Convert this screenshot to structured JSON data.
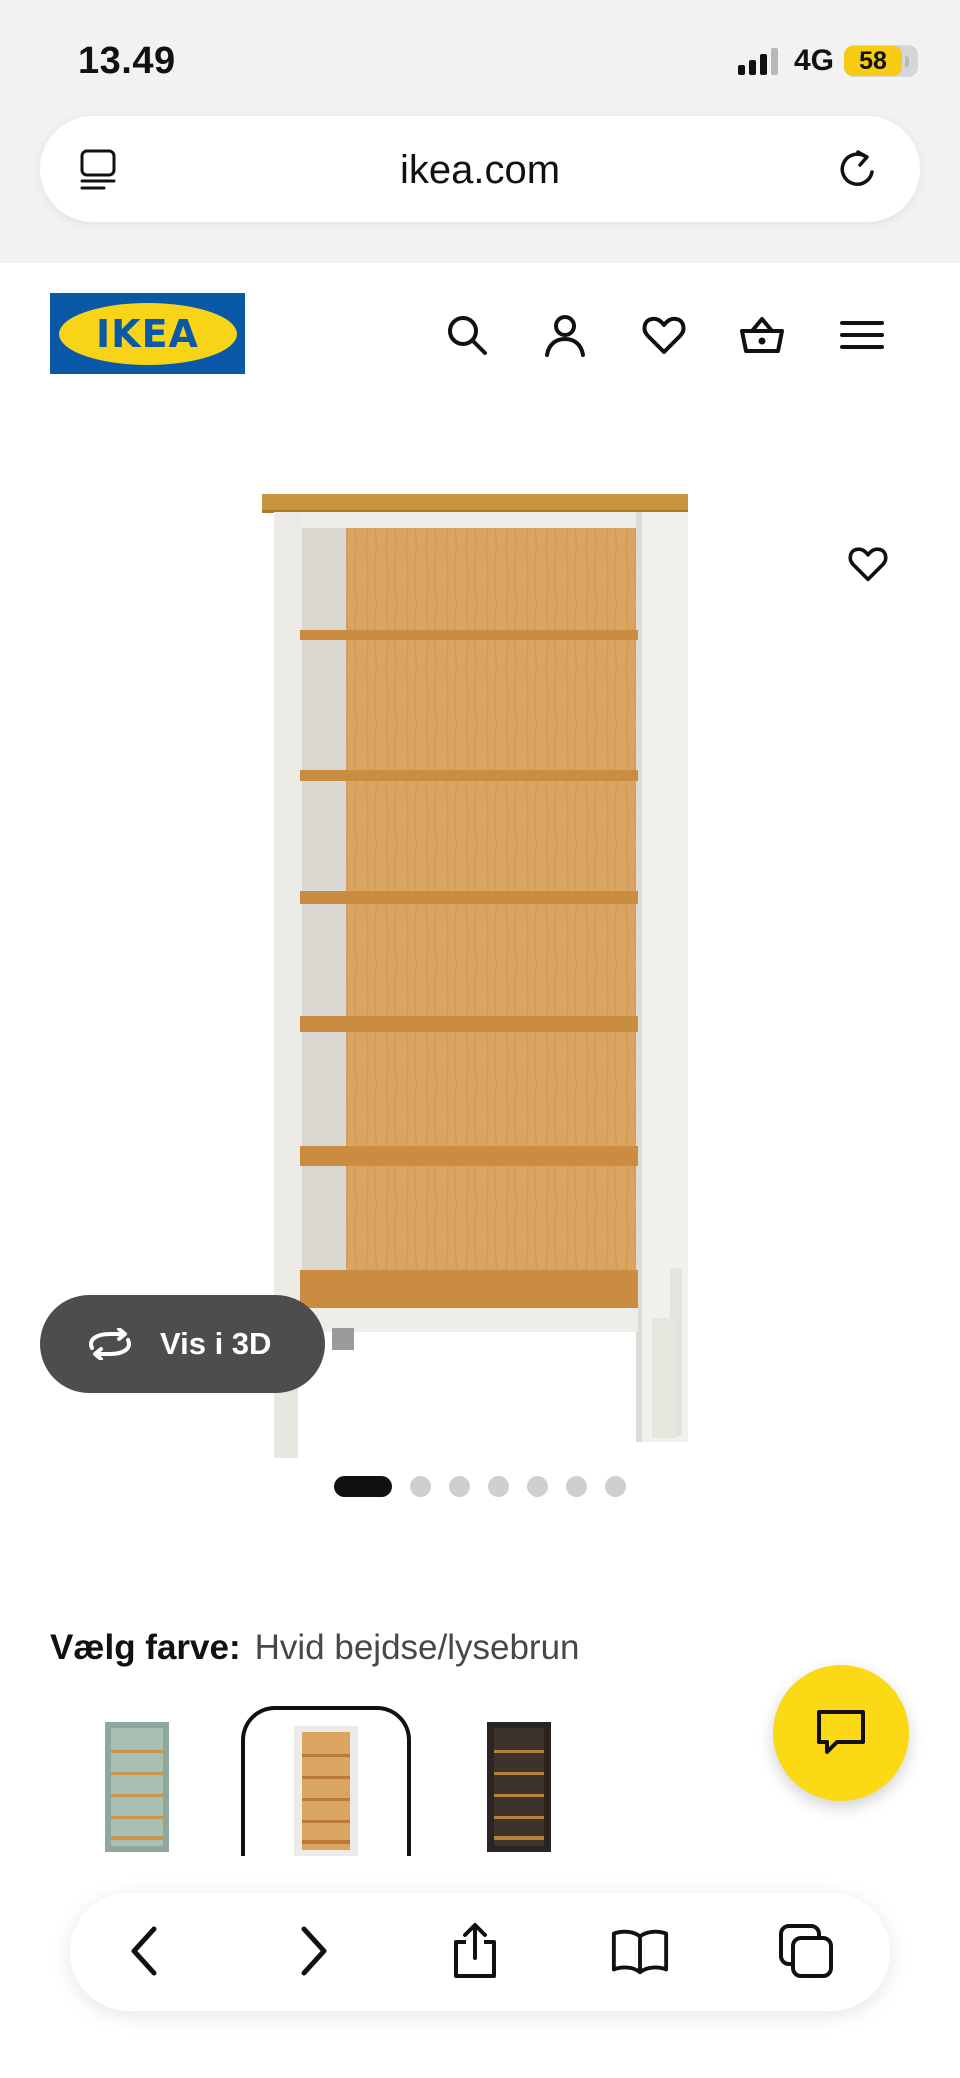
{
  "status_bar": {
    "time": "13.49",
    "network": "4G",
    "battery": "58"
  },
  "browser": {
    "url": "ikea.com"
  },
  "header": {
    "logo_text": "IKEA"
  },
  "product": {
    "view_3d_label": "Vis i 3D",
    "image_count": 7,
    "active_image": 1
  },
  "color_picker": {
    "label": "Vælg farve:",
    "selected": "Hvid bejdse/lysebrun"
  },
  "colors": {
    "ikea_blue": "#0a58a8",
    "ikea_yellow": "#f7d417",
    "chat_yellow": "#fbd914",
    "button_dark": "#4d4d4d"
  }
}
